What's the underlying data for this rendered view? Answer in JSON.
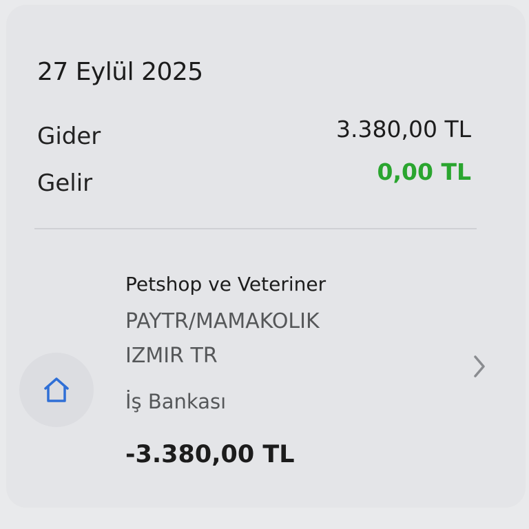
{
  "summary": {
    "date": "27 Eylül 2025",
    "expense_label": "Gider",
    "expense_value": "3.380,00 TL",
    "income_label": "Gelir",
    "income_value": "0,00 TL"
  },
  "transaction": {
    "category": "Petshop ve Veteriner",
    "description_line1": "PAYTR/MAMAKOLIK",
    "description_line2": "IZMIR TR",
    "bank": "İş Bankası",
    "amount": "-3.380,00 TL",
    "category_icon": "home-icon"
  },
  "colors": {
    "income_green": "#2aa52f",
    "icon_blue": "#2f6fd6"
  }
}
